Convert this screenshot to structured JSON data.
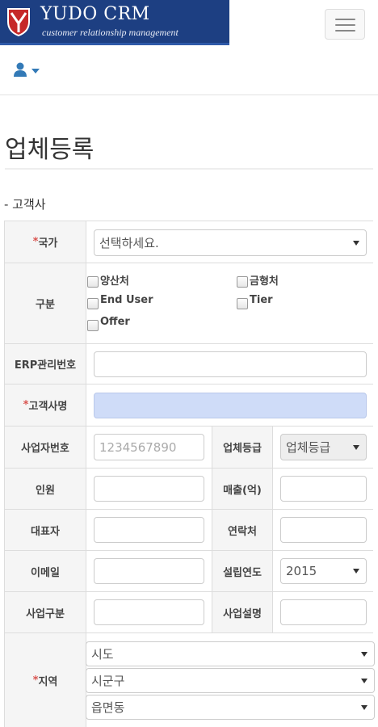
{
  "header": {
    "brand_title": "YUDO CRM",
    "brand_subtitle": "customer relationship management",
    "brand_color": "#1d3f82",
    "user_icon": "user-icon"
  },
  "page": {
    "title": "업체등록",
    "section": "- 고객사"
  },
  "form": {
    "country": {
      "label": "국가",
      "required": "*",
      "value": "선택하세요."
    },
    "category": {
      "label": "구분",
      "options": [
        "양산처",
        "금형처",
        "End User",
        "Tier",
        "Offer"
      ]
    },
    "erp": {
      "label": "ERP관리번호",
      "value": ""
    },
    "customer_name": {
      "label": "고객사명",
      "required": "*",
      "value": ""
    },
    "business_number": {
      "label": "사업자번호",
      "placeholder": "1234567890"
    },
    "grade": {
      "label": "업체등급",
      "value": "업체등급"
    },
    "headcount": {
      "label": "인원",
      "value": ""
    },
    "sales": {
      "label": "매출(억)",
      "value": ""
    },
    "ceo": {
      "label": "대표자",
      "value": ""
    },
    "contact": {
      "label": "연락처",
      "value": ""
    },
    "email": {
      "label": "이메일",
      "value": ""
    },
    "founded": {
      "label": "설립연도",
      "value": "2015"
    },
    "business_type": {
      "label": "사업구분",
      "value": ""
    },
    "business_desc": {
      "label": "사업설명",
      "value": ""
    },
    "region": {
      "label": "지역",
      "required": "*",
      "province": "시도",
      "city": "시군구",
      "town": "읍면동"
    }
  }
}
